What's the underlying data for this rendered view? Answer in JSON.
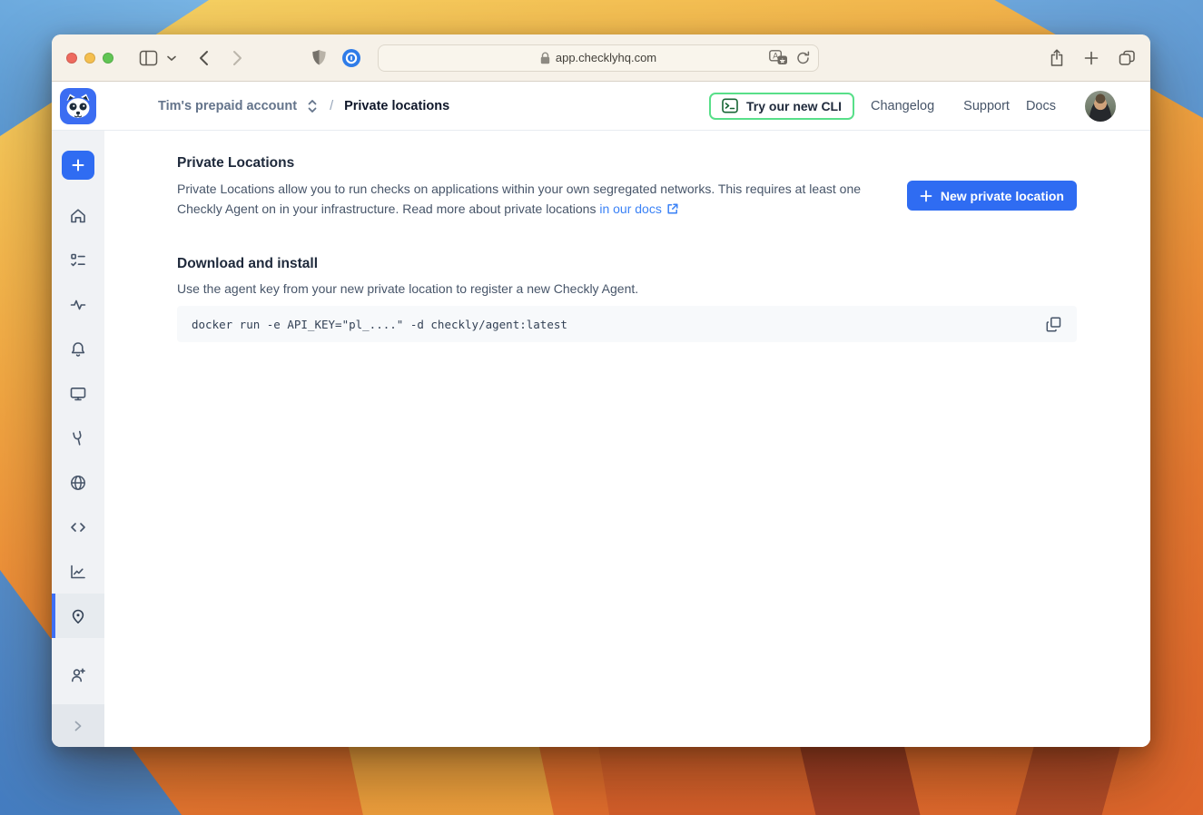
{
  "browser": {
    "url": "app.checklyhq.com",
    "toolbar_icons": [
      "sidebar-toggle-icon",
      "chevron-down-icon",
      "back-icon",
      "forward-icon",
      "shield-icon",
      "onepassword-icon",
      "lock-icon",
      "translate-icon",
      "reload-icon",
      "share-icon",
      "new-tab-icon",
      "tabs-icon"
    ]
  },
  "header": {
    "account": "Tim's prepaid account",
    "separator": "/",
    "page_title": "Private locations",
    "cli_button_label": "Try our new CLI",
    "nav_links": [
      "Changelog",
      "Support",
      "Docs"
    ]
  },
  "sidebar": {
    "icons": [
      "plus-icon",
      "home-icon",
      "checks-icon",
      "activity-icon",
      "bell-icon",
      "monitor-icon",
      "wrench-icon",
      "globe-icon",
      "code-icon",
      "chart-icon",
      "location-pin-icon",
      "add-user-icon",
      "chevron-right-icon"
    ],
    "active_item": "private-locations"
  },
  "main": {
    "title": "Private Locations",
    "intro_text": "Private Locations allow you to run checks on applications within your own segregated networks. This requires at least one Checkly Agent on in your infrastructure. Read more about private locations",
    "intro_link": "in our docs",
    "new_location_button": "New private location",
    "section_title": "Download and install",
    "section_text": "Use the agent key from your new private location to register a new Checkly Agent.",
    "code_snippet": "docker run -e API_KEY=\"pl_....\" -d checkly/agent:latest"
  },
  "colors": {
    "accent_blue": "#2f6cf2",
    "link_blue": "#3b82f6",
    "cli_border_green": "#58df89",
    "cli_icon_green": "#166534",
    "sidebar_active_bar": "#3e6ff4"
  }
}
